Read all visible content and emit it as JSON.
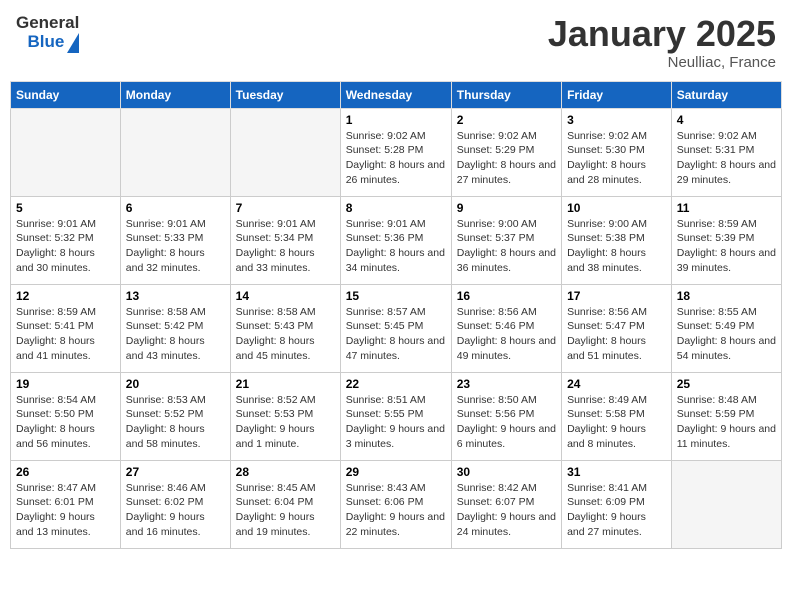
{
  "header": {
    "logo_general": "General",
    "logo_blue": "Blue",
    "month": "January 2025",
    "location": "Neulliac, France"
  },
  "weekdays": [
    "Sunday",
    "Monday",
    "Tuesday",
    "Wednesday",
    "Thursday",
    "Friday",
    "Saturday"
  ],
  "weeks": [
    [
      {
        "day": "",
        "empty": true
      },
      {
        "day": "",
        "empty": true
      },
      {
        "day": "",
        "empty": true
      },
      {
        "day": "1",
        "sunrise": "9:02 AM",
        "sunset": "5:28 PM",
        "daylight": "8 hours and 26 minutes."
      },
      {
        "day": "2",
        "sunrise": "9:02 AM",
        "sunset": "5:29 PM",
        "daylight": "8 hours and 27 minutes."
      },
      {
        "day": "3",
        "sunrise": "9:02 AM",
        "sunset": "5:30 PM",
        "daylight": "8 hours and 28 minutes."
      },
      {
        "day": "4",
        "sunrise": "9:02 AM",
        "sunset": "5:31 PM",
        "daylight": "8 hours and 29 minutes."
      }
    ],
    [
      {
        "day": "5",
        "sunrise": "9:01 AM",
        "sunset": "5:32 PM",
        "daylight": "8 hours and 30 minutes."
      },
      {
        "day": "6",
        "sunrise": "9:01 AM",
        "sunset": "5:33 PM",
        "daylight": "8 hours and 32 minutes."
      },
      {
        "day": "7",
        "sunrise": "9:01 AM",
        "sunset": "5:34 PM",
        "daylight": "8 hours and 33 minutes."
      },
      {
        "day": "8",
        "sunrise": "9:01 AM",
        "sunset": "5:36 PM",
        "daylight": "8 hours and 34 minutes."
      },
      {
        "day": "9",
        "sunrise": "9:00 AM",
        "sunset": "5:37 PM",
        "daylight": "8 hours and 36 minutes."
      },
      {
        "day": "10",
        "sunrise": "9:00 AM",
        "sunset": "5:38 PM",
        "daylight": "8 hours and 38 minutes."
      },
      {
        "day": "11",
        "sunrise": "8:59 AM",
        "sunset": "5:39 PM",
        "daylight": "8 hours and 39 minutes."
      }
    ],
    [
      {
        "day": "12",
        "sunrise": "8:59 AM",
        "sunset": "5:41 PM",
        "daylight": "8 hours and 41 minutes."
      },
      {
        "day": "13",
        "sunrise": "8:58 AM",
        "sunset": "5:42 PM",
        "daylight": "8 hours and 43 minutes."
      },
      {
        "day": "14",
        "sunrise": "8:58 AM",
        "sunset": "5:43 PM",
        "daylight": "8 hours and 45 minutes."
      },
      {
        "day": "15",
        "sunrise": "8:57 AM",
        "sunset": "5:45 PM",
        "daylight": "8 hours and 47 minutes."
      },
      {
        "day": "16",
        "sunrise": "8:56 AM",
        "sunset": "5:46 PM",
        "daylight": "8 hours and 49 minutes."
      },
      {
        "day": "17",
        "sunrise": "8:56 AM",
        "sunset": "5:47 PM",
        "daylight": "8 hours and 51 minutes."
      },
      {
        "day": "18",
        "sunrise": "8:55 AM",
        "sunset": "5:49 PM",
        "daylight": "8 hours and 54 minutes."
      }
    ],
    [
      {
        "day": "19",
        "sunrise": "8:54 AM",
        "sunset": "5:50 PM",
        "daylight": "8 hours and 56 minutes."
      },
      {
        "day": "20",
        "sunrise": "8:53 AM",
        "sunset": "5:52 PM",
        "daylight": "8 hours and 58 minutes."
      },
      {
        "day": "21",
        "sunrise": "8:52 AM",
        "sunset": "5:53 PM",
        "daylight": "9 hours and 1 minute."
      },
      {
        "day": "22",
        "sunrise": "8:51 AM",
        "sunset": "5:55 PM",
        "daylight": "9 hours and 3 minutes."
      },
      {
        "day": "23",
        "sunrise": "8:50 AM",
        "sunset": "5:56 PM",
        "daylight": "9 hours and 6 minutes."
      },
      {
        "day": "24",
        "sunrise": "8:49 AM",
        "sunset": "5:58 PM",
        "daylight": "9 hours and 8 minutes."
      },
      {
        "day": "25",
        "sunrise": "8:48 AM",
        "sunset": "5:59 PM",
        "daylight": "9 hours and 11 minutes."
      }
    ],
    [
      {
        "day": "26",
        "sunrise": "8:47 AM",
        "sunset": "6:01 PM",
        "daylight": "9 hours and 13 minutes."
      },
      {
        "day": "27",
        "sunrise": "8:46 AM",
        "sunset": "6:02 PM",
        "daylight": "9 hours and 16 minutes."
      },
      {
        "day": "28",
        "sunrise": "8:45 AM",
        "sunset": "6:04 PM",
        "daylight": "9 hours and 19 minutes."
      },
      {
        "day": "29",
        "sunrise": "8:43 AM",
        "sunset": "6:06 PM",
        "daylight": "9 hours and 22 minutes."
      },
      {
        "day": "30",
        "sunrise": "8:42 AM",
        "sunset": "6:07 PM",
        "daylight": "9 hours and 24 minutes."
      },
      {
        "day": "31",
        "sunrise": "8:41 AM",
        "sunset": "6:09 PM",
        "daylight": "9 hours and 27 minutes."
      },
      {
        "day": "",
        "empty": true
      }
    ]
  ]
}
